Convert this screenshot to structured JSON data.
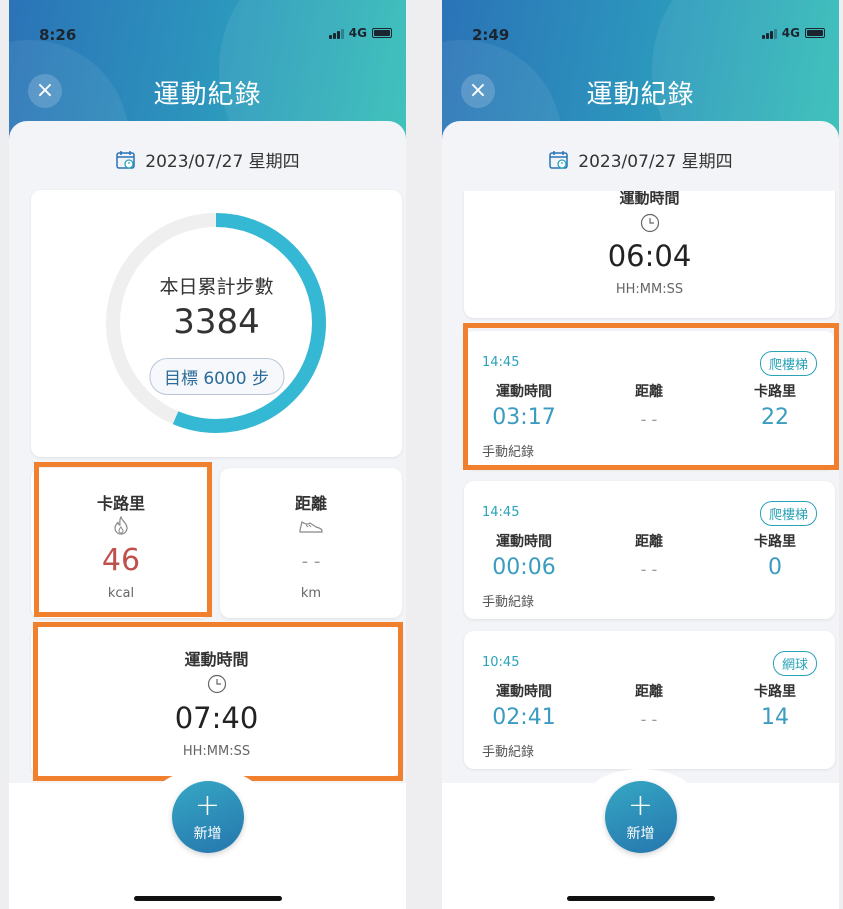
{
  "left": {
    "status": {
      "time": "8:26",
      "network": "4G"
    },
    "header": {
      "close_icon": "×",
      "title": "運動紀錄"
    },
    "date": "2023/07/27 星期四",
    "steps": {
      "label": "本日累計步數",
      "value": "3384",
      "goal": "目標 6000 步",
      "progress": 0.564
    },
    "calories": {
      "title": "卡路里",
      "value": "46",
      "unit": "kcal",
      "icon": "fire-icon"
    },
    "distance": {
      "title": "距離",
      "value": "- -",
      "unit": "km",
      "icon": "shoe-icon"
    },
    "exercise_time": {
      "title": "運動時間",
      "value": "07:40",
      "unit": "HH:MM:SS",
      "icon": "clock-icon"
    },
    "add_button": {
      "plus": "+",
      "label": "新增"
    }
  },
  "right": {
    "status": {
      "time": "2:49",
      "network": "4G"
    },
    "header": {
      "close_icon": "×",
      "title": "運動紀錄"
    },
    "date": "2023/07/27 星期四",
    "partial_card": {
      "title": "運動時間",
      "value": "06:04",
      "unit": "HH:MM:SS"
    },
    "records": [
      {
        "time": "14:45",
        "activity": "爬樓梯",
        "duration_label": "運動時間",
        "duration": "03:17",
        "distance_label": "距離",
        "distance": "- -",
        "calories_label": "卡路里",
        "calories": "22",
        "note": "手動紀錄"
      },
      {
        "time": "14:45",
        "activity": "爬樓梯",
        "duration_label": "運動時間",
        "duration": "00:06",
        "distance_label": "距離",
        "distance": "- -",
        "calories_label": "卡路里",
        "calories": "0",
        "note": "手動紀錄"
      },
      {
        "time": "10:45",
        "activity": "網球",
        "duration_label": "運動時間",
        "duration": "02:41",
        "distance_label": "距離",
        "distance": "- -",
        "calories_label": "卡路里",
        "calories": "14",
        "note": "手動紀錄"
      }
    ],
    "add_button": {
      "plus": "+",
      "label": "新增"
    }
  },
  "colors": {
    "highlight": "#f07f2e",
    "ring": "#35b8d4",
    "calorie_value": "#c0504d",
    "accent": "#2aa3b8"
  }
}
